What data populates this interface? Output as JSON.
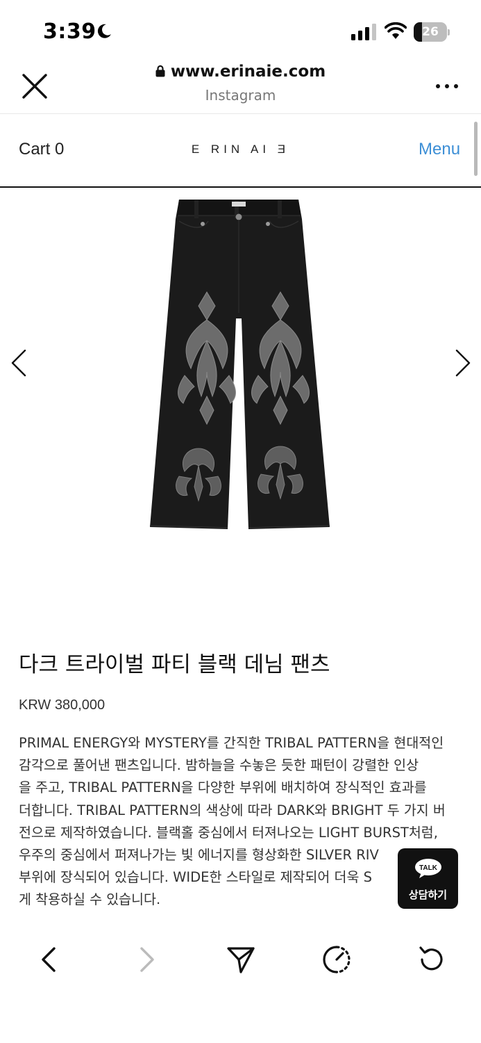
{
  "status": {
    "time": "3:39",
    "battery_level": "26",
    "battery_fraction": 0.26
  },
  "browser": {
    "url": "www.erinaie.com",
    "source": "Instagram"
  },
  "site_nav": {
    "cart_label": "Cart 0",
    "logo_text": "E RIN AI Ǝ",
    "menu_label": "Menu"
  },
  "product": {
    "title": "다크 트라이벌 파티 블랙 데님 팬츠",
    "price": "KRW 380,000",
    "description_lines": [
      "PRIMAL ENERGY와 MYSTERY를 간직한 TRIBAL PATTERN을 현대적인",
      "감각으로 풀어낸 팬츠입니다. 밤하늘을 수놓은 듯한 패턴이 강렬한 인상",
      "을 주고, TRIBAL PATTERN을 다양한 부위에 배치하여 장식적인 효과를",
      "더합니다. TRIBAL PATTERN의 색상에 따라 DARK와 BRIGHT 두 가지 버",
      "전으로 제작하였습니다. 블랙홀 중심에서 터져나오는 LIGHT BURST처럼,",
      "우주의 중심에서 퍼져나가는 빛 에너지를 형상화한 SILVER RIV",
      "부위에 장식되어 있습니다. WIDE한 스타일로 제작되어 더욱 S",
      "게 착용하실 수 있습니다."
    ]
  },
  "talk_button": {
    "badge": "TALK",
    "label": "상담하기"
  },
  "icons": {
    "close": "close-icon",
    "more": "more-icon",
    "back": "chevron-left-icon",
    "forward": "chevron-right-icon",
    "share": "send-icon",
    "speed": "speed-icon",
    "reload": "reload-icon"
  },
  "colors": {
    "menu_link": "#3d8fd6",
    "talk_bg": "#111111"
  }
}
